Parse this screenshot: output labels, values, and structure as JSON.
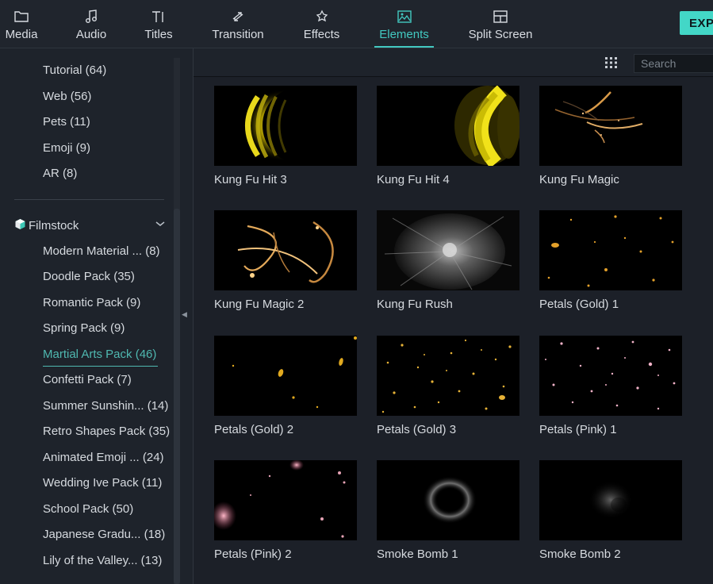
{
  "toolbar": {
    "tabs": [
      {
        "label": "Media",
        "icon": "folder-icon"
      },
      {
        "label": "Audio",
        "icon": "music-note-icon"
      },
      {
        "label": "Titles",
        "icon": "text-icon"
      },
      {
        "label": "Transition",
        "icon": "transition-icon"
      },
      {
        "label": "Effects",
        "icon": "effects-icon"
      },
      {
        "label": "Elements",
        "icon": "image-icon",
        "active": true
      },
      {
        "label": "Split Screen",
        "icon": "split-screen-icon"
      }
    ],
    "export_label": "EXP"
  },
  "sidebar": {
    "top_items": [
      {
        "label": "Tutorial (64)"
      },
      {
        "label": "Web (56)"
      },
      {
        "label": "Pets (11)"
      },
      {
        "label": "Emoji (9)"
      },
      {
        "label": "AR (8)"
      }
    ],
    "section_title": "Filmstock",
    "section_items": [
      {
        "label": "Modern Material ... (8)"
      },
      {
        "label": "Doodle Pack (35)"
      },
      {
        "label": "Romantic Pack (9)"
      },
      {
        "label": "Spring Pack (9)"
      },
      {
        "label": "Martial Arts Pack (46)",
        "active": true
      },
      {
        "label": "Confetti Pack (7)"
      },
      {
        "label": "Summer Sunshin... (14)"
      },
      {
        "label": "Retro Shapes Pack (35)"
      },
      {
        "label": "Animated Emoji ... (24)"
      },
      {
        "label": "Wedding Ive Pack (11)"
      },
      {
        "label": "School Pack (50)"
      },
      {
        "label": "Japanese Gradu... (18)"
      },
      {
        "label": "Lily of the Valley... (13)"
      }
    ]
  },
  "main": {
    "search_placeholder": "Search",
    "items": [
      {
        "title": "Kung Fu Hit 3"
      },
      {
        "title": "Kung Fu Hit 4"
      },
      {
        "title": "Kung Fu Magic"
      },
      {
        "title": "Kung Fu Magic 2"
      },
      {
        "title": "Kung Fu Rush"
      },
      {
        "title": "Petals (Gold) 1"
      },
      {
        "title": "Petals (Gold) 2"
      },
      {
        "title": "Petals (Gold) 3"
      },
      {
        "title": "Petals (Pink) 1"
      },
      {
        "title": "Petals (Pink) 2"
      },
      {
        "title": "Smoke Bomb 1"
      },
      {
        "title": "Smoke Bomb 2"
      }
    ]
  },
  "colors": {
    "accent": "#42c9c1",
    "background": "#1c2028",
    "export": "#43d7c7"
  }
}
